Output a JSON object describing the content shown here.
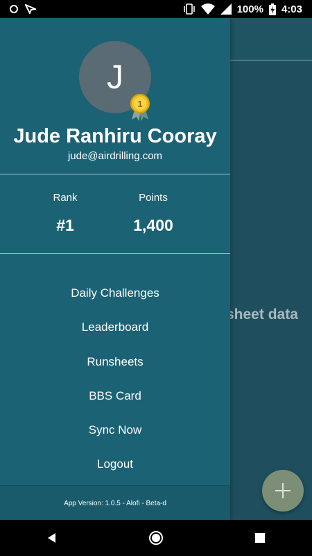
{
  "status_bar": {
    "battery": "100%",
    "time": "4:03"
  },
  "background": {
    "partial_text": "sheet data"
  },
  "drawer": {
    "avatar_initial": "J",
    "medal_number": "1",
    "user_name": "Jude Ranhiru Cooray",
    "user_email": "jude@airdrilling.com",
    "stats": {
      "rank_label": "Rank",
      "rank_value": "#1",
      "points_label": "Points",
      "points_value": "1,400"
    },
    "menu": [
      {
        "label": "Daily Challenges"
      },
      {
        "label": "Leaderboard"
      },
      {
        "label": "Runsheets"
      },
      {
        "label": "BBS Card"
      },
      {
        "label": "Sync Now"
      },
      {
        "label": "Logout"
      }
    ],
    "version": "App Version: 1.0.5 - Alofi - Beta-d"
  },
  "colors": {
    "drawer_bg": "#1c6275",
    "background_bg": "#1f4f5e",
    "fab_bg": "#7d8e77",
    "medal_gold": "#f2c21b"
  },
  "icons": {
    "status_left": [
      "circle-icon",
      "notification-icon"
    ],
    "status_right": [
      "vibrate-icon",
      "wifi-icon",
      "signal-icon",
      "battery-charging-icon"
    ],
    "fab": "plus-icon",
    "nav": [
      "back-icon",
      "home-icon",
      "recents-icon"
    ]
  }
}
